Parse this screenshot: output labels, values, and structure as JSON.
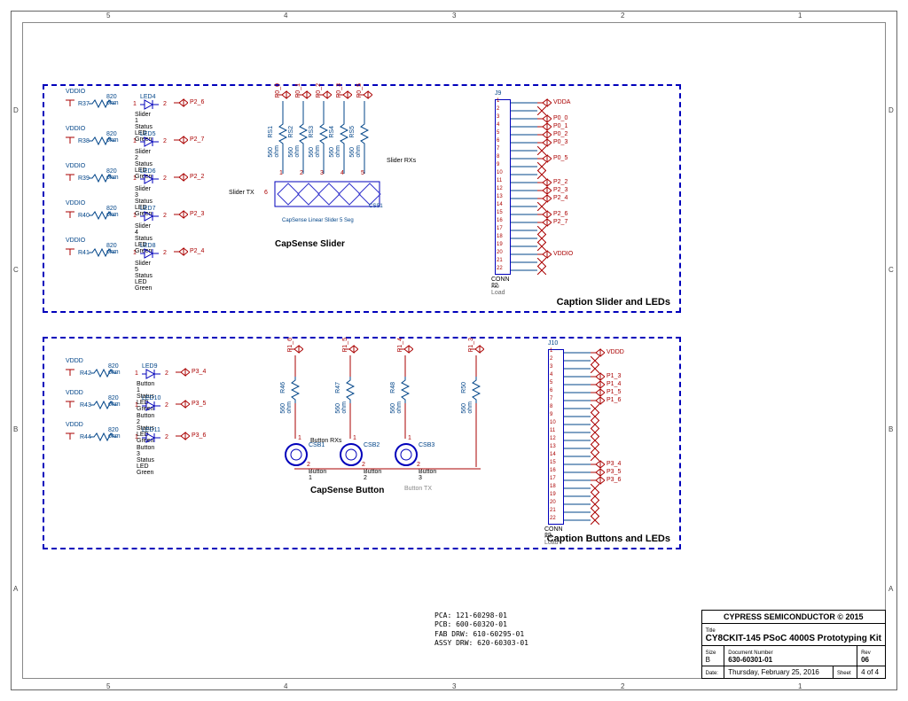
{
  "sections": {
    "slider": {
      "caption": "Caption Slider and LEDs",
      "title": "CapSense Slider",
      "subtitle": "CapSense Linear Slider 5 Seg",
      "csref": "CSS1",
      "tx_label": "Slider TX",
      "rx_label": "Slider RXs"
    },
    "button": {
      "caption": "Caption Buttons and LEDs",
      "title": "CapSense Button",
      "tx_label": "Button TX",
      "rx_label": "Button RXs"
    }
  },
  "slider_leds": [
    {
      "r": "R37",
      "led": "LED4",
      "net": "P2_6",
      "desc": "Slider 1 Status LED Green"
    },
    {
      "r": "R38",
      "led": "LED5",
      "net": "P2_7",
      "desc": "Slider 2 Status LED Green"
    },
    {
      "r": "R39",
      "led": "LED6",
      "net": "P2_2",
      "desc": "Slider 3 Status LED Green"
    },
    {
      "r": "R40",
      "led": "LED7",
      "net": "P2_3",
      "desc": "Slider 4 Status LED Green"
    },
    {
      "r": "R41",
      "led": "LED8",
      "net": "P2_4",
      "desc": "Slider 5 Status LED Green"
    }
  ],
  "button_leds": [
    {
      "r": "R42",
      "led": "LED9",
      "net": "P3_4",
      "desc": "Button 1 Status LED Green"
    },
    {
      "r": "R43",
      "led": "LED10",
      "net": "P3_5",
      "desc": "Button 2 Status LED Green"
    },
    {
      "r": "R44",
      "led": "LED11",
      "net": "P3_6",
      "desc": "Button 3 Status LED Green"
    }
  ],
  "slider_rx": [
    {
      "r": "RS1",
      "net": "P0_0"
    },
    {
      "r": "RS2",
      "net": "P0_1"
    },
    {
      "r": "RS3",
      "net": "P0_2"
    },
    {
      "r": "RS4",
      "net": "P0_3"
    },
    {
      "r": "RS5",
      "net": "P0_5"
    }
  ],
  "button_rx": [
    {
      "r": "R46",
      "net": "P1_6",
      "btn": "CSB1",
      "bl": "Button 1"
    },
    {
      "r": "R47",
      "net": "P1_5",
      "btn": "CSB2",
      "bl": "Button 2"
    },
    {
      "r": "R48",
      "net": "P1_4",
      "btn": "CSB3",
      "bl": "Button 3"
    }
  ],
  "button_tx": {
    "r": "R50",
    "net": "P1_3"
  },
  "res_val_560": "560 ohm",
  "res_val_820": "820 ohm",
  "pwr1": "VDDIO",
  "pwr2": "VDDD",
  "pwr3": "VDDA",
  "conn": {
    "ref1": "J9",
    "ref2": "J10",
    "type": "CONN 22",
    "note": "No Load",
    "pins": 22
  },
  "j9_nets": [
    "VDDA",
    "",
    "P0_0",
    "P0_1",
    "P0_2",
    "P0_3",
    "",
    "P0_5",
    "",
    "",
    "P2_2",
    "P2_3",
    "P2_4",
    "",
    "P2_6",
    "P2_7",
    "",
    "",
    "",
    "VDDIO",
    "",
    ""
  ],
  "j10_nets": [
    "VDDD",
    "",
    "",
    "P1_3",
    "P1_4",
    "P1_5",
    "P1_6",
    "",
    "",
    "",
    "",
    "",
    "",
    "",
    "P3_4",
    "P3_5",
    "P3_6",
    "",
    "",
    "",
    "",
    ""
  ],
  "pin_1": "1",
  "pin_2": "2",
  "pin_6": "6",
  "build": {
    "pca": "PCA: 121-60298-01",
    "pcb": "PCB: 600-60320-01",
    "fab": "FAB DRW: 610-60295-01",
    "assy": "ASSY DRW: 620-60303-01"
  },
  "title_block": {
    "company": "CYPRESS SEMICONDUCTOR © 2015",
    "title_hdr": "Title",
    "title": "CY8CKIT-145 PSoC 4000S Prototyping Kit",
    "size_hdr": "Size",
    "size": "B",
    "doc_hdr": "Document Number",
    "doc": "630-60301-01",
    "rev_hdr": "Rev",
    "rev": "06",
    "date_hdr": "Date:",
    "date": "Thursday, February 25, 2016",
    "sheet_hdr": "Sheet",
    "sheet_of": "4   of   4"
  },
  "ticks": {
    "top": [
      "5",
      "4",
      "3",
      "2",
      "1"
    ],
    "side": [
      "D",
      "C",
      "B",
      "A"
    ]
  }
}
